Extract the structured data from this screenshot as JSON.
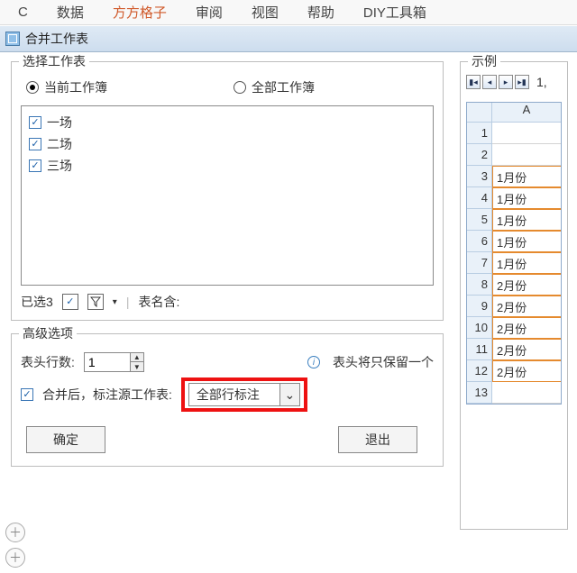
{
  "menubar": {
    "items": [
      "C",
      "数据",
      "方方格子",
      "审阅",
      "视图",
      "帮助",
      "DIY工具箱"
    ],
    "active_index": 2
  },
  "window": {
    "title": "合并工作表"
  },
  "select_group": {
    "title": "选择工作表",
    "radio_current": "当前工作簿",
    "radio_all": "全部工作簿",
    "radio_selected": "current",
    "items": [
      {
        "label": "一场",
        "checked": true
      },
      {
        "label": "二场",
        "checked": true
      },
      {
        "label": "三场",
        "checked": true
      }
    ],
    "status_count": "已选3",
    "status_namelabel": "表名含:"
  },
  "advanced": {
    "title": "高级选项",
    "header_rows_label": "表头行数:",
    "header_rows_value": "1",
    "tip": "表头将只保留一个",
    "merge_after_label": "合并后，标注源工作表:",
    "merge_after_checked": true,
    "source_mode": "全部行标注"
  },
  "buttons": {
    "ok": "确定",
    "cancel": "退出"
  },
  "example": {
    "title": "示例",
    "nav_text": "1,",
    "col_header": "A",
    "rows": [
      {
        "n": 1,
        "v": ""
      },
      {
        "n": 2,
        "v": ""
      },
      {
        "n": 3,
        "v": "1月份"
      },
      {
        "n": 4,
        "v": "1月份"
      },
      {
        "n": 5,
        "v": "1月份"
      },
      {
        "n": 6,
        "v": "1月份"
      },
      {
        "n": 7,
        "v": "1月份"
      },
      {
        "n": 8,
        "v": "2月份"
      },
      {
        "n": 9,
        "v": "2月份"
      },
      {
        "n": 10,
        "v": "2月份"
      },
      {
        "n": 11,
        "v": "2月份"
      },
      {
        "n": 12,
        "v": "2月份"
      },
      {
        "n": 13,
        "v": ""
      }
    ]
  }
}
